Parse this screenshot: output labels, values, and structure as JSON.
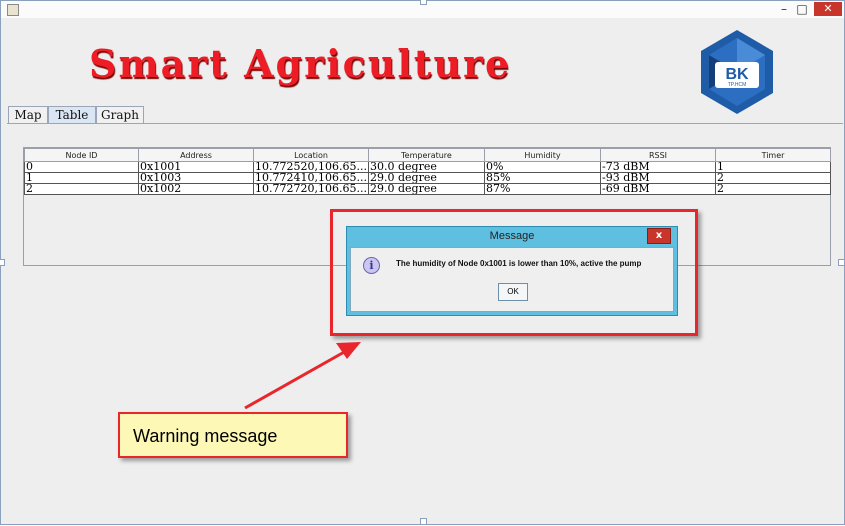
{
  "window": {
    "minimize_glyph": "–",
    "maximize_glyph": "□",
    "close_glyph": "✕"
  },
  "app": {
    "title": "Smart Agriculture",
    "logo_text": "BK",
    "logo_subtext": "TP.HCM"
  },
  "tabs": [
    {
      "label": "Map"
    },
    {
      "label": "Table"
    },
    {
      "label": "Graph"
    }
  ],
  "table": {
    "headers": [
      "Node ID",
      "Address",
      "Location",
      "Temperature",
      "Humidity",
      "RSSI",
      "Timer"
    ],
    "rows": [
      [
        "0",
        "0x1001",
        "10.772520,106.65...",
        "30.0 degree",
        "0%",
        "-73 dBM",
        "1"
      ],
      [
        "1",
        "0x1003",
        "10.772410,106.65...",
        "29.0 degree",
        "85%",
        "-93 dBM",
        "2"
      ],
      [
        "2",
        "0x1002",
        "10.772720,106.65...",
        "29.0 degree",
        "87%",
        "-69 dBM",
        "2"
      ]
    ]
  },
  "dialog": {
    "title": "Message",
    "close_glyph": "x",
    "icon": "information-icon",
    "icon_glyph": "i",
    "text": "The humidity of Node 0x1001 is lower than 10%, active the pump",
    "ok_label": "OK"
  },
  "annotation": {
    "text": "Warning message"
  },
  "colors": {
    "title_red": "#ee1c25",
    "annotation_red": "#e8262b",
    "dialog_blue": "#5ebfe0",
    "callout_yellow": "#fdf8b6",
    "logo_blue": "#1f5ca8"
  }
}
